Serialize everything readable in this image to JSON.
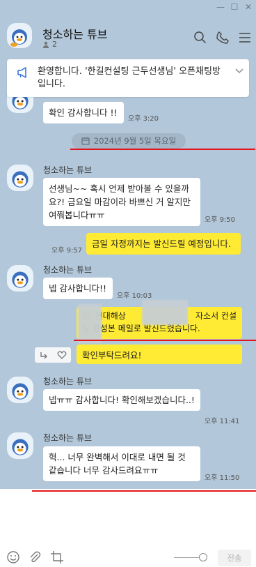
{
  "window": {
    "controls": [
      "minimize",
      "maximize",
      "close"
    ]
  },
  "header": {
    "room_title": "청소하는 튜브",
    "member_count": "2",
    "icons": [
      "search-icon",
      "call-icon",
      "menu-icon"
    ]
  },
  "notice": {
    "icon": "megaphone-icon",
    "text": "환영합니다. '한길컨설팅 근두선생님' 오픈채팅방입니다."
  },
  "date_separator": "2024년 9월 5일 목요일",
  "messages": [
    {
      "from": "other",
      "text": "확인 감사합니다 !!",
      "time": "오후 3:20"
    },
    {
      "from": "other",
      "sender": "청소하는 튜브",
      "text": "선생님~~ 혹시 언제 받아볼 수 있을까요?! 금요일 마감이라 바쁘신 거 알지만 여쭤봅니다ㅠㅠ",
      "time": "오후 9:50"
    },
    {
      "from": "me",
      "text": "금일 자정까지는 발신드릴 예정입니다.",
      "time": "오후 9:57"
    },
    {
      "from": "other",
      "sender": "청소하는 튜브",
      "text": "넵 감사합니다!!",
      "time": "오후 10:03"
    },
    {
      "from": "me",
      "text_fragments": [
        "님, 현대해상",
        "자소서 컨설",
        "팅 완성본 메일로 발신드렸습니다."
      ],
      "text": "확인부탁드려요!"
    },
    {
      "from": "other",
      "sender": "청소하는 튜브",
      "text": "넵ㅠㅠ 감사합니다! 확인해보겠습니다..!",
      "time": "오후 11:41"
    },
    {
      "from": "other",
      "sender": "청소하는 튜브",
      "text": "헉... 너무 완벽해서 이대로 내면 될 것 같습니다 너무 감사드려요ㅠㅠ",
      "time": "오후 11:50"
    }
  ],
  "composer": {
    "tools": [
      "emoji-icon",
      "attach-icon",
      "crop-icon"
    ],
    "send_label": "전송"
  },
  "colors": {
    "chat_background": "#b2c7d9",
    "my_bubble": "#ffeb33",
    "other_bubble": "#ffffff",
    "annotation_line": "#e3141c"
  }
}
